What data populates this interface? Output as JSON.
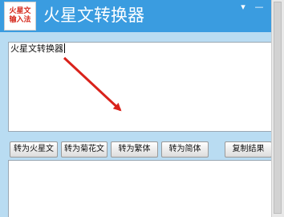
{
  "app": {
    "logo_line1": "火星文",
    "logo_line2": "输入法",
    "title": "火星文转换器"
  },
  "window_controls": {
    "dropdown_icon": "▾",
    "minimize_icon": "—"
  },
  "input": {
    "value": "火星文转换器"
  },
  "buttons": {
    "to_martian": "转为火星文",
    "to_chrysanthemum": "转为菊花文",
    "to_traditional": "转为繁体",
    "to_simplified": "转为简体",
    "copy_result": "复制结果"
  },
  "output": {
    "value": ""
  },
  "colors": {
    "titlebar": "#3a9ce0",
    "panel": "#b9dcf2",
    "arrow": "#d9221b"
  }
}
